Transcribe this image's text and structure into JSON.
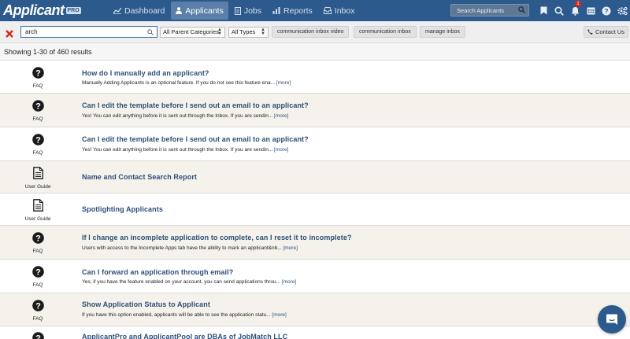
{
  "app": {
    "logo_text": "Applicant",
    "logo_badge": "PRO"
  },
  "nav": {
    "tabs": [
      {
        "label": "Dashboard",
        "icon": "chart-icon",
        "active": false
      },
      {
        "label": "Applicants",
        "icon": "person-icon",
        "active": true
      },
      {
        "label": "Jobs",
        "icon": "document-icon",
        "active": false
      },
      {
        "label": "Reports",
        "icon": "bar-chart-icon",
        "active": false
      },
      {
        "label": "Inbox",
        "icon": "inbox-icon",
        "active": false
      }
    ],
    "search_placeholder": "Search Applicants",
    "notification_count": "1",
    "icons": [
      "bookmark-icon",
      "search-icon",
      "bell-icon",
      "calendar-icon",
      "help-icon",
      "gear-icon"
    ]
  },
  "filters": {
    "search_value": "arch",
    "category_select": "All Parent Categories",
    "type_select": "All Types",
    "chips": [
      "communication inbox video",
      "communication inbox",
      "manage inbox"
    ],
    "contact_label": "Contact Us"
  },
  "results_summary": "Showing 1-30 of 460 results",
  "more_label": "[more]",
  "results": [
    {
      "type": "FAQ",
      "icon": "question-icon",
      "title": "How do I manually add an applicant?",
      "snippet": "Manually Adding Applicants is an optional feature. If you do not see this feature ena..."
    },
    {
      "type": "FAQ",
      "icon": "question-icon",
      "title": "Can I edit the template before I send out an email to an applicant?",
      "snippet": "Yes! You can edit anything before it is sent out through the Inbox. If you are sendin..."
    },
    {
      "type": "FAQ",
      "icon": "question-icon",
      "title": "Can I edit the template before I send out an email to an applicant?",
      "snippet": "Yes! You can edit anything before it is sent out through the Inbox. If you are sendin..."
    },
    {
      "type": "User Guide",
      "icon": "document-icon",
      "title": "Name and Contact Search Report",
      "snippet": ""
    },
    {
      "type": "User Guide",
      "icon": "document-icon",
      "title": "Spotlighting Applicants",
      "snippet": ""
    },
    {
      "type": "FAQ",
      "icon": "question-icon",
      "title": "If I change an incomplete application to complete, can I reset it to incomplete?",
      "snippet": "Users with access to the Incomplete Apps tab have the ability to mark an applicant&nb..."
    },
    {
      "type": "FAQ",
      "icon": "question-icon",
      "title": "Can I forward an application through email?",
      "snippet": "Yes; if you have the feature enabled on your account, you can send applications throu..."
    },
    {
      "type": "FAQ",
      "icon": "question-icon",
      "title": "Show Application Status to Applicant",
      "snippet": "If you have this option enabled, applicants will be able to see the application statu..."
    },
    {
      "type": "FAQ",
      "icon": "question-icon",
      "title": "ApplicantPro and ApplicantPool are DBAs of JobMatch LLC",
      "snippet": ""
    }
  ],
  "colors": {
    "nav_bg": "#2c5a8c",
    "link_blue": "#2d4f78",
    "row_alt": "#f4f2ea",
    "clear_red": "#d9251c"
  }
}
